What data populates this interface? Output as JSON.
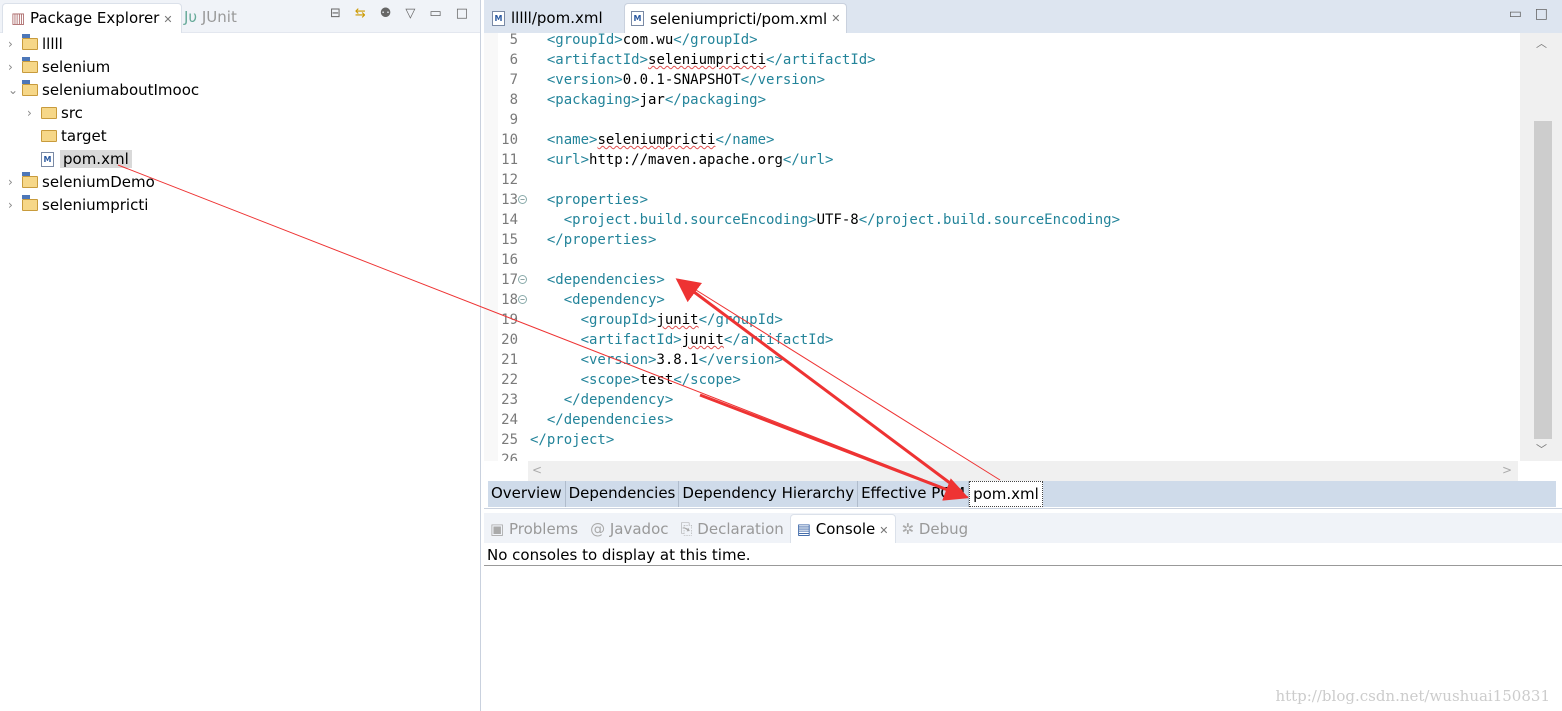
{
  "explorer": {
    "tab_label": "Package Explorer",
    "junit_tab": "JUnit",
    "items": [
      {
        "label": "lllll",
        "type": "maven-project",
        "expanded": false,
        "level": 0
      },
      {
        "label": "selenium",
        "type": "java-project",
        "expanded": false,
        "level": 0
      },
      {
        "label": "seleniumaboutImooc",
        "type": "maven-project",
        "expanded": true,
        "level": 0
      },
      {
        "label": "src",
        "type": "folder",
        "expanded": false,
        "level": 1
      },
      {
        "label": "target",
        "type": "folder",
        "level": 1
      },
      {
        "label": "pom.xml",
        "type": "maven-file",
        "level": 1,
        "selected": true
      },
      {
        "label": "seleniumDemo",
        "type": "java-project",
        "expanded": false,
        "level": 0
      },
      {
        "label": "seleniumpricti",
        "type": "maven-project",
        "expanded": false,
        "level": 0
      }
    ]
  },
  "editor": {
    "tabs": [
      {
        "label": "lllll/pom.xml",
        "active": false
      },
      {
        "label": "seleniumpricti/pom.xml",
        "active": true
      }
    ],
    "lines": [
      {
        "n": "5",
        "i": 1,
        "s": [
          [
            "t",
            "<groupId>"
          ],
          [
            "x",
            "com.wu"
          ],
          [
            "t",
            "</groupId>"
          ]
        ]
      },
      {
        "n": "6",
        "i": 1,
        "s": [
          [
            "t",
            "<artifactId>"
          ],
          [
            "q",
            "seleniumpricti"
          ],
          [
            "t",
            "</artifactId>"
          ]
        ]
      },
      {
        "n": "7",
        "i": 1,
        "s": [
          [
            "t",
            "<version>"
          ],
          [
            "x",
            "0.0.1-SNAPSHOT"
          ],
          [
            "t",
            "</version>"
          ]
        ]
      },
      {
        "n": "8",
        "i": 1,
        "s": [
          [
            "t",
            "<packaging>"
          ],
          [
            "x",
            "jar"
          ],
          [
            "t",
            "</packaging>"
          ]
        ]
      },
      {
        "n": "9",
        "i": 0,
        "s": []
      },
      {
        "n": "10",
        "i": 1,
        "s": [
          [
            "t",
            "<name>"
          ],
          [
            "q",
            "seleniumpricti"
          ],
          [
            "t",
            "</name>"
          ]
        ]
      },
      {
        "n": "11",
        "i": 1,
        "s": [
          [
            "t",
            "<url>"
          ],
          [
            "x",
            "http://maven.apache.org"
          ],
          [
            "t",
            "</url>"
          ]
        ]
      },
      {
        "n": "12",
        "i": 0,
        "s": []
      },
      {
        "n": "13",
        "i": 1,
        "f": true,
        "s": [
          [
            "t",
            "<properties>"
          ]
        ]
      },
      {
        "n": "14",
        "i": 2,
        "s": [
          [
            "t",
            "<project.build.sourceEncoding>"
          ],
          [
            "x",
            "UTF-8"
          ],
          [
            "t",
            "</project.build.sourceEncoding>"
          ]
        ]
      },
      {
        "n": "15",
        "i": 1,
        "s": [
          [
            "t",
            "</properties>"
          ]
        ]
      },
      {
        "n": "16",
        "i": 0,
        "s": []
      },
      {
        "n": "17",
        "i": 1,
        "f": true,
        "s": [
          [
            "t",
            "<dependencies>"
          ]
        ]
      },
      {
        "n": "18",
        "i": 2,
        "f": true,
        "s": [
          [
            "t",
            "<dependency>"
          ]
        ]
      },
      {
        "n": "19",
        "i": 3,
        "s": [
          [
            "t",
            "<groupId>"
          ],
          [
            "q",
            "junit"
          ],
          [
            "t",
            "</groupId>"
          ]
        ]
      },
      {
        "n": "20",
        "i": 3,
        "s": [
          [
            "t",
            "<artifactId>"
          ],
          [
            "q",
            "junit"
          ],
          [
            "t",
            "</artifactId>"
          ]
        ]
      },
      {
        "n": "21",
        "i": 3,
        "s": [
          [
            "t",
            "<version>"
          ],
          [
            "x",
            "3.8.1"
          ],
          [
            "t",
            "</version>"
          ]
        ]
      },
      {
        "n": "22",
        "i": 3,
        "s": [
          [
            "t",
            "<scope>"
          ],
          [
            "x",
            "test"
          ],
          [
            "t",
            "</scope>"
          ]
        ]
      },
      {
        "n": "23",
        "i": 2,
        "s": [
          [
            "t",
            "</dependency>"
          ]
        ]
      },
      {
        "n": "24",
        "i": 1,
        "s": [
          [
            "t",
            "</dependencies>"
          ]
        ]
      },
      {
        "n": "25",
        "i": 0,
        "s": [
          [
            "t",
            "</project>"
          ]
        ]
      },
      {
        "n": "26",
        "i": 0,
        "s": []
      }
    ],
    "page_tabs": [
      {
        "label": "Overview"
      },
      {
        "label": "Dependencies"
      },
      {
        "label": "Dependency Hierarchy"
      },
      {
        "label": "Effective POM"
      },
      {
        "label": "pom.xml",
        "active": true
      }
    ]
  },
  "bottom": {
    "tabs": [
      {
        "label": "Problems"
      },
      {
        "label": "Javadoc"
      },
      {
        "label": "Declaration"
      },
      {
        "label": "Console",
        "active": true
      },
      {
        "label": "Debug"
      }
    ],
    "console_message": "No consoles to display at this time."
  },
  "watermark": "http://blog.csdn.net/wushuai150831",
  "colors": {
    "xml_tag": "#23849a",
    "annotation_arrow": "#ee3333"
  }
}
